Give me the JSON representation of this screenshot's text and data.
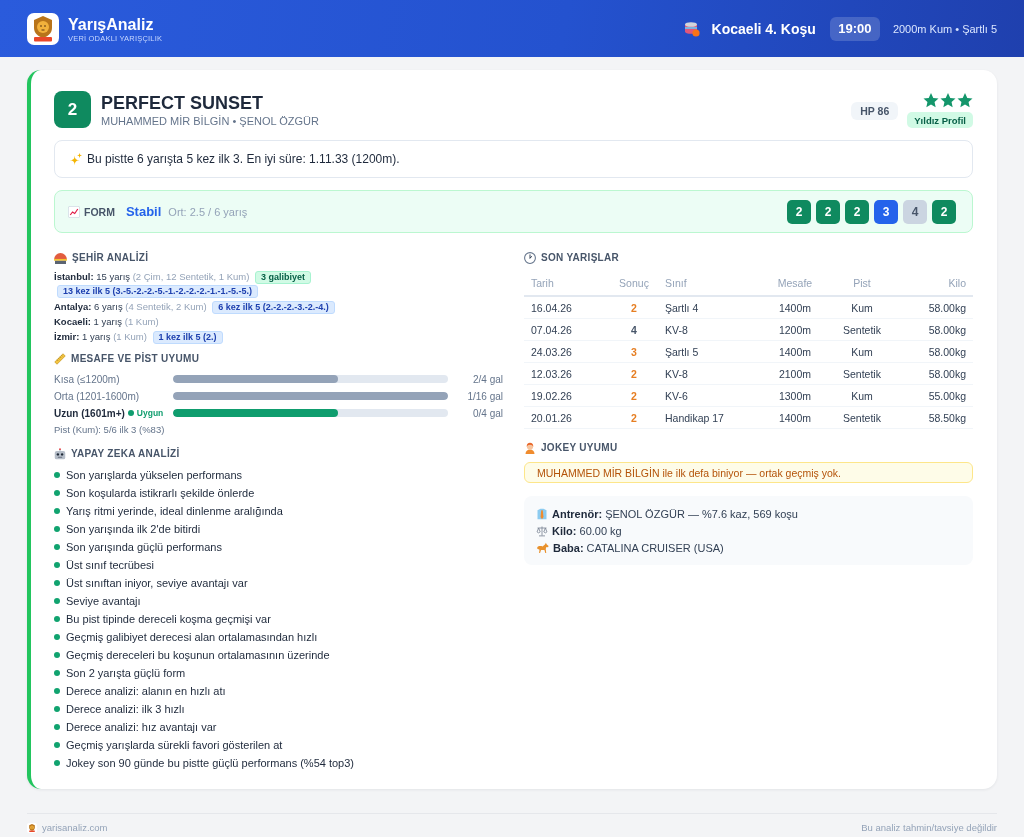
{
  "header": {
    "brand": {
      "name": "YarışAnaliz",
      "tagline": "VERİ ODAKLI YARIŞÇILIK"
    },
    "race": {
      "title": "Kocaeli 4. Koşu",
      "time": "19:00",
      "details": "2000m Kum • Şartlı 5"
    }
  },
  "horse": {
    "number": "2",
    "name": "PERFECT SUNSET",
    "subtitle": "MUHAMMED MİR BİLGİN • ŞENOL ÖZGÜR",
    "rating": "HP 86",
    "stars": 3,
    "profile_tag": "Yıldız Profil",
    "highlight": "Bu pistte 6 yarışta 5 kez ilk 3. En iyi süre: 1.11.33 (1200m)."
  },
  "form": {
    "label": "FORM",
    "trend": "Stabil",
    "summary": "Ort: 2.5 / 6 yarış",
    "results": [
      {
        "text": "2",
        "color": "#0f8a5f"
      },
      {
        "text": "2",
        "color": "#0f8a5f"
      },
      {
        "text": "2",
        "color": "#0f8a5f"
      },
      {
        "text": "3",
        "color": "#2563eb"
      },
      {
        "text": "4",
        "color": "#cbd5e1"
      },
      {
        "text": "2",
        "color": "#0f8a5f"
      }
    ]
  },
  "city_analysis": {
    "title": "ŞEHİR ANALİZİ",
    "cities": [
      {
        "name": "İstanbul:",
        "races": "15 yarış",
        "breakdown": "(2 Çim, 12 Sentetik, 1 Kum)",
        "tags": [
          {
            "kind": "win",
            "text": "3 galibiyet"
          },
          {
            "kind": "top5",
            "text": "13 kez ilk 5 (3.-5.-2.-2.-5.-1.-2.-2.-2.-1.-1.-5.-5.)"
          }
        ]
      },
      {
        "name": "Antalya:",
        "races": "6 yarış",
        "breakdown": "(4 Sentetik, 2 Kum)",
        "tags": [
          {
            "kind": "top5",
            "text": "6 kez ilk 5 (2.-2.-2.-3.-2.-4.)"
          }
        ]
      },
      {
        "name": "Kocaeli:",
        "races": "1 yarış",
        "breakdown": "(1 Kum)"
      },
      {
        "name": "İzmir:",
        "races": "1 yarış",
        "breakdown": "(1 Kum)",
        "tags": [
          {
            "kind": "top5",
            "text": "1 kez ilk 5 (2.)"
          }
        ]
      }
    ]
  },
  "distance_fit": {
    "title": "MESAFE VE PİST UYUMU",
    "rows": [
      {
        "label": "Kısa (≤1200m)",
        "level": 0.6,
        "reading": "2/4 gal",
        "suitable": false
      },
      {
        "label": "Orta (1201-1600m)",
        "level": 1,
        "reading": "1/16 gal",
        "suitable": false
      },
      {
        "label": "Uzun (1601m+)",
        "level": 0.6,
        "reading": "0/4 gal",
        "suitable": true,
        "tag": "Uygun"
      }
    ],
    "track_summary": "Pist (Kum): 5/6 ilk 3 (%83)"
  },
  "ai_analysis": {
    "title": "YAPAY ZEKA ANALİZİ",
    "items": [
      "Son yarışlarda yükselen performans",
      "Son koşularda istikrarlı şekilde önlerde",
      "Yarış ritmi yerinde, ideal dinlenme aralığında",
      "Son yarışında ilk 2'de bitirdi",
      "Son yarışında güçlü performans",
      "Üst sınıf tecrübesi",
      "Üst sınıftan iniyor, seviye avantajı var",
      "Seviye avantajı",
      "Bu pist tipinde dereceli koşma geçmişi var",
      "Geçmiş galibiyet derecesi alan ortalamasından hızlı",
      "Geçmiş dereceleri bu koşunun ortalamasının üzerinde",
      "Son 2 yarışta güçlü form",
      "Derece analizi: alanın en hızlı atı",
      "Derece analizi: ilk 3 hızlı",
      "Derece analizi: hız avantajı var",
      "Geçmiş yarışlarda sürekli favori gösterilen at",
      "Jokey son 90 günde bu pistte güçlü performans (%54 top3)"
    ]
  },
  "recent_races": {
    "title": "SON YARIŞLAR",
    "columns": [
      "Tarih",
      "Sonuç",
      "Sınıf",
      "Mesafe",
      "Pist",
      "Kilo"
    ],
    "rows": [
      {
        "date": "16.04.26",
        "result": "2",
        "color": "#e67e22",
        "class": "Şartlı 4",
        "distance": "1400m",
        "track": "Kum",
        "weight": "58.00kg"
      },
      {
        "date": "07.04.26",
        "result": "4",
        "color": "#475569",
        "class": "KV-8",
        "distance": "1200m",
        "track": "Sentetik",
        "weight": "58.00kg"
      },
      {
        "date": "24.03.26",
        "result": "3",
        "color": "#e67e22",
        "class": "Şartlı 5",
        "distance": "1400m",
        "track": "Kum",
        "weight": "58.00kg"
      },
      {
        "date": "12.03.26",
        "result": "2",
        "color": "#e67e22",
        "class": "KV-8",
        "distance": "2100m",
        "track": "Sentetik",
        "weight": "58.00kg"
      },
      {
        "date": "19.02.26",
        "result": "2",
        "color": "#e67e22",
        "class": "KV-6",
        "distance": "1300m",
        "track": "Kum",
        "weight": "55.00kg"
      },
      {
        "date": "20.01.26",
        "result": "2",
        "color": "#e67e22",
        "class": "Handikap 17",
        "distance": "1400m",
        "track": "Sentetik",
        "weight": "58.50kg"
      }
    ]
  },
  "jockey_fit": {
    "title": "JOKEY UYUMU",
    "notice": "MUHAMMED MİR BİLGİN ile ilk defa biniyor — ortak geçmiş yok."
  },
  "details": [
    {
      "kind": "trainer",
      "label": "Antrenör:",
      "value": "ŞENOL ÖZGÜR — %7.6 kaz, 569 koşu"
    },
    {
      "kind": "weight",
      "label": "Kilo:",
      "value": "60.00 kg"
    },
    {
      "kind": "sire",
      "label": "Baba:",
      "value": "CATALINA CRUISER (USA)"
    }
  ],
  "footer": {
    "site": "yarisanaliz.com",
    "disclaimer": "Bu analiz tahmin/tavsiye değildir"
  }
}
